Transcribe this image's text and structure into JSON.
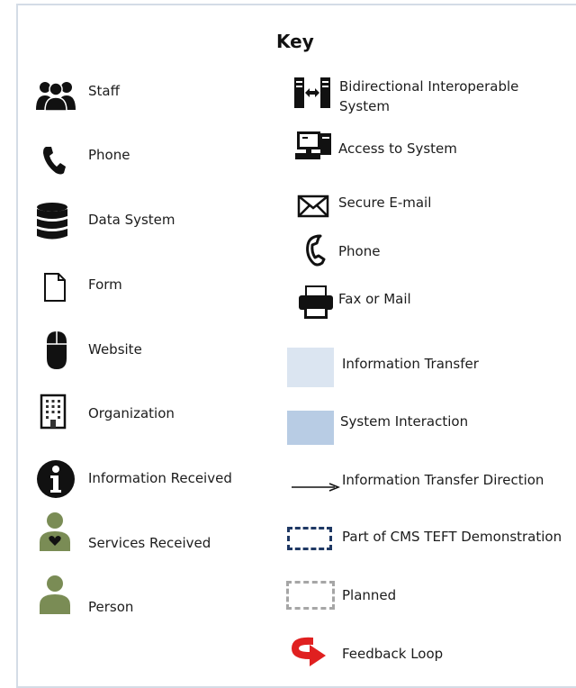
{
  "key": {
    "title": "Key",
    "left": [
      {
        "label": "Staff",
        "icon": "staff-icon"
      },
      {
        "label": "Phone",
        "icon": "phone-icon"
      },
      {
        "label": "Data System",
        "icon": "data-system-icon"
      },
      {
        "label": "Form",
        "icon": "form-icon"
      },
      {
        "label": "Website",
        "icon": "website-mouse-icon"
      },
      {
        "label": "Organization",
        "icon": "organization-building-icon"
      },
      {
        "label": "Information Received",
        "icon": "information-icon"
      },
      {
        "label": "Services Received",
        "icon": "services-received-person-icon"
      },
      {
        "label": "Person",
        "icon": "person-icon"
      }
    ],
    "right": [
      {
        "label_line1": "Bidirectional Interoperable",
        "label_line2": "System",
        "icon": "bidirectional-system-icon"
      },
      {
        "label": "Access to System",
        "icon": "computer-access-icon"
      },
      {
        "label": "Secure E-mail",
        "icon": "envelope-icon"
      },
      {
        "label": "Phone",
        "icon": "phone-handset-icon"
      },
      {
        "label": "Fax or Mail",
        "icon": "fax-printer-icon"
      },
      {
        "label": "Information Transfer",
        "icon": "light-blue-swatch",
        "color": "#dbe5f1"
      },
      {
        "label": "System Interaction",
        "icon": "blue-swatch",
        "color": "#b8cce4"
      },
      {
        "label": "Information Transfer Direction",
        "icon": "arrow-icon"
      },
      {
        "label": "Part of CMS TEFT Demonstration",
        "icon": "dashed-navy-box",
        "color": "#1f3864"
      },
      {
        "label": "Planned",
        "icon": "dashed-gray-box",
        "color": "#a6a6a6"
      },
      {
        "label": "Feedback Loop",
        "icon": "feedback-loop-arrow-icon",
        "color": "#e02020"
      }
    ],
    "colors": {
      "person_green": "#7a8c55",
      "frame": "#d4dce6"
    }
  }
}
